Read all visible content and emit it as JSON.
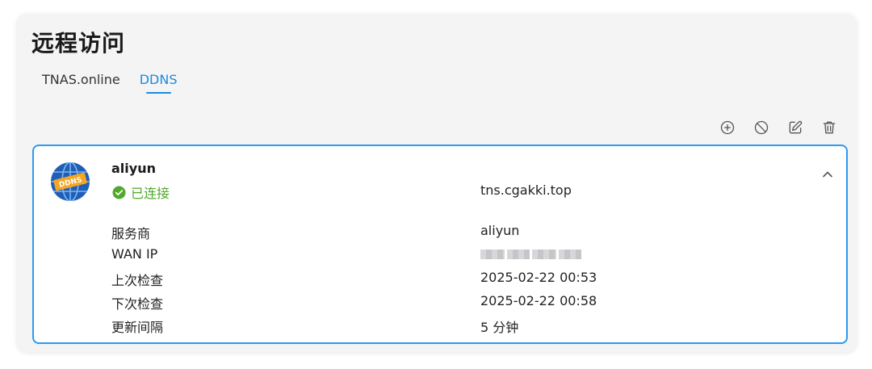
{
  "page": {
    "title": "远程访问"
  },
  "tabs": [
    {
      "label": "TNAS.online",
      "active": false
    },
    {
      "label": "DDNS",
      "active": true
    }
  ],
  "toolbar": {
    "add_icon": "plus-circle-icon",
    "disable_icon": "block-icon",
    "edit_icon": "edit-icon",
    "delete_icon": "trash-icon"
  },
  "entry": {
    "icon": "ddns-globe-icon",
    "badge_text": "DDNS",
    "name": "aliyun",
    "status": "已连接",
    "domain": "tns.cgakki.top",
    "details": [
      {
        "label": "服务商",
        "value": "aliyun"
      },
      {
        "label": "WAN IP",
        "value": ""
      },
      {
        "label": "上次检查",
        "value": "2025-02-22 00:53"
      },
      {
        "label": "下次检查",
        "value": "2025-02-22 00:58"
      },
      {
        "label": "更新间隔",
        "value": "5 分钟"
      }
    ]
  },
  "colors": {
    "accent": "#1a8ce0",
    "card_border": "#2b9af3",
    "status_green": "#52a82c",
    "panel_bg": "#f4f4f5"
  }
}
